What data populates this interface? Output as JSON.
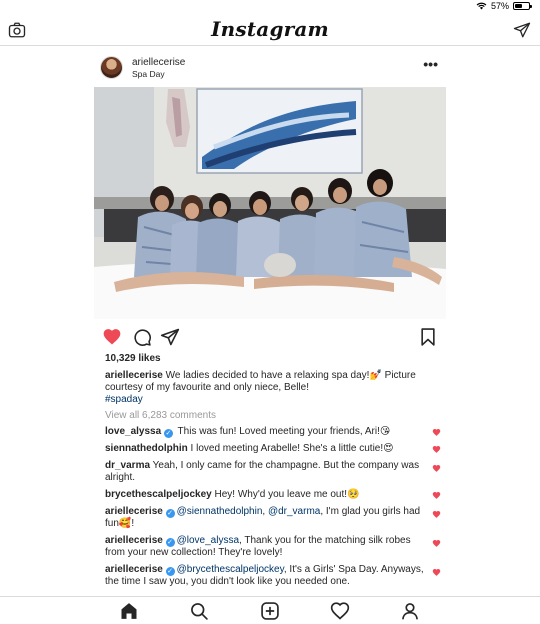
{
  "status_bar": {
    "battery_text": "57%",
    "battery_level": 0.57
  },
  "header": {
    "logo": "Instagram",
    "camera_icon": "camera-icon",
    "direct_icon": "direct-message-icon"
  },
  "post": {
    "username": "ariellecerise",
    "location": "Spa Day",
    "more_icon": "more-options-icon",
    "more_text": "•••",
    "likes": "10,329 likes",
    "caption_user": "ariellecerise",
    "caption_text": " We ladies decided to have a relaxing spa day!💅 Picture courtesy of my favourite and only niece, Belle!",
    "hashtag": "#spaday",
    "view_all": "View all 6,283 comments",
    "liked": true
  },
  "comments": [
    {
      "user": "love_alyssa",
      "verified": true,
      "text": " This was fun! Loved meeting your friends, Ari!😘"
    },
    {
      "user": "siennathedolphin",
      "verified": false,
      "text": " I loved meeting Arabelle! She's a little cutie!😍"
    },
    {
      "user": "dr_varma",
      "verified": false,
      "text": " Yeah, I only came for the champagne. But the company was alright."
    },
    {
      "user": "brycethescalpeljockey",
      "verified": false,
      "text": " Hey! Why'd you leave me out!🥺"
    },
    {
      "user": "ariellecerise",
      "verified": true,
      "mention1": "@siennathedolphin",
      "sep": ", ",
      "mention2": "@dr_varma",
      "text": ", I'm glad you girls had fun🥰!"
    },
    {
      "user": "ariellecerise",
      "verified": true,
      "mention1": "@love_alyssa",
      "text": ", Thank you for the matching silk robes from your new collection! They're lovely!"
    },
    {
      "user": "ariellecerise",
      "verified": true,
      "mention1": "@brycethescalpeljockey",
      "text": ", It's a Girls' Spa Day. Anyways, the time I saw you, you didn't look like you needed one."
    }
  ],
  "bottom_nav": [
    "home-icon",
    "search-icon",
    "new-post-icon",
    "activity-icon",
    "profile-icon"
  ],
  "colors": {
    "like_red": "#ed4956",
    "link_blue": "#003569",
    "verified_blue": "#3897f0"
  }
}
